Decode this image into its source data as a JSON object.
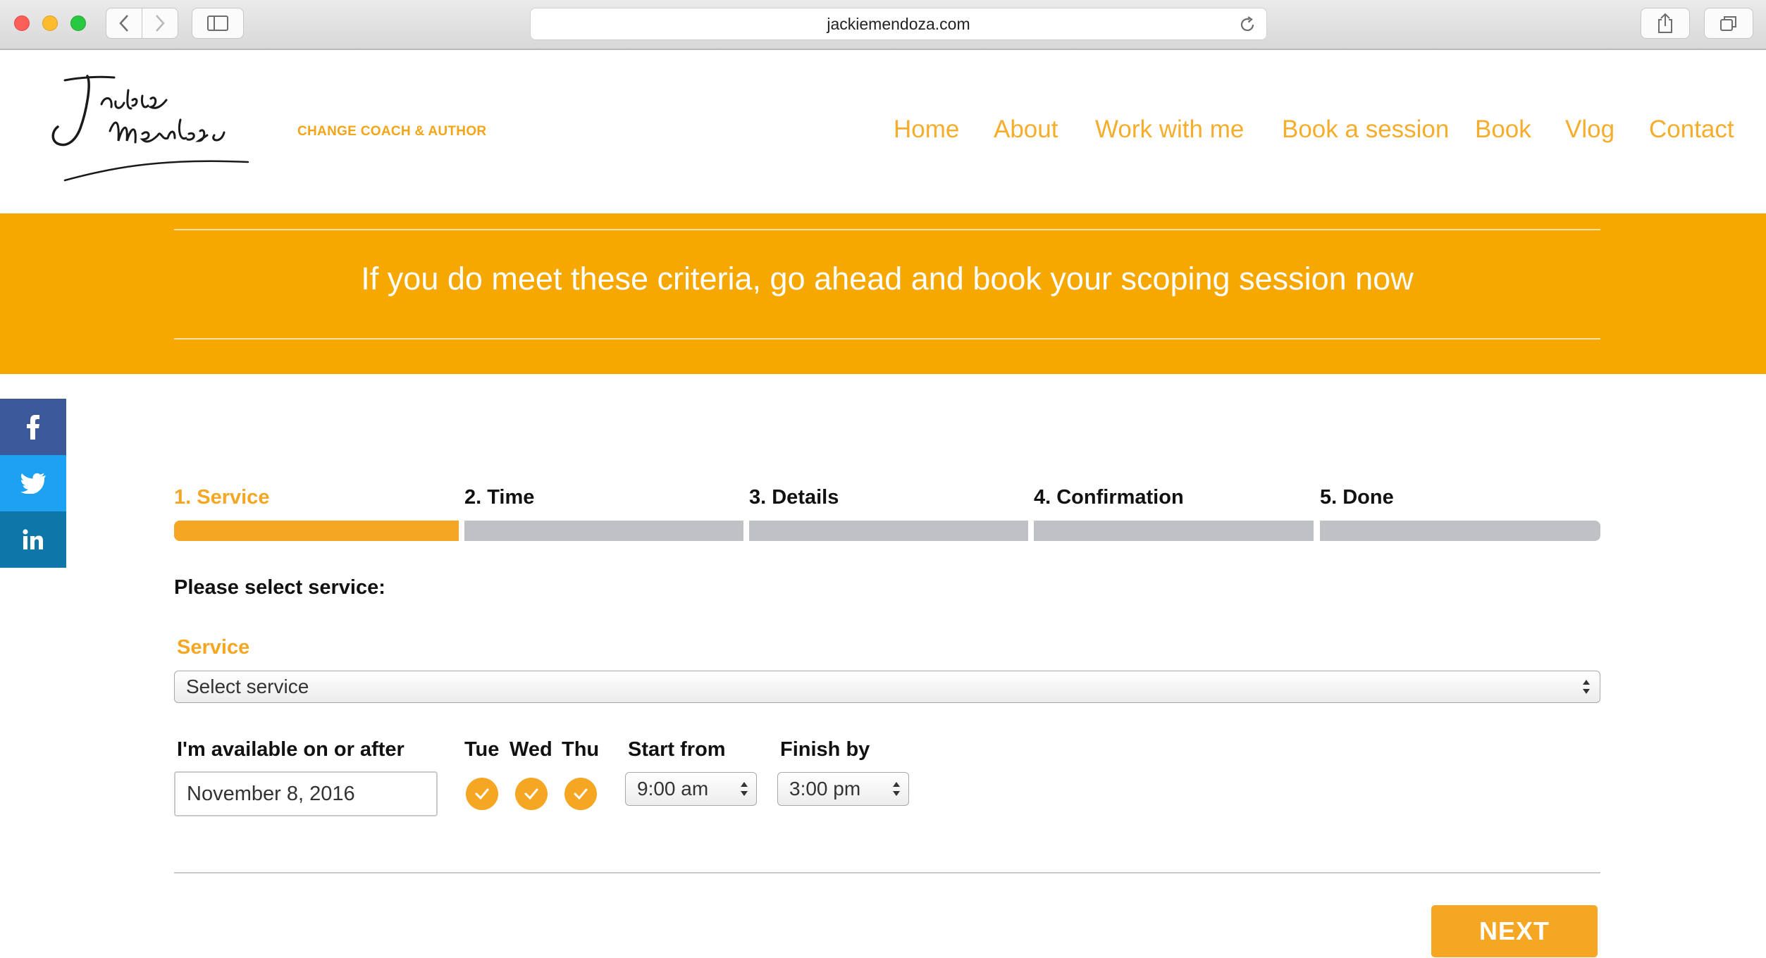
{
  "browser": {
    "url": "jackiemendoza.com"
  },
  "site": {
    "logo_text": "Jackie Mendoza",
    "tagline": "CHANGE COACH & AUTHOR",
    "nav": [
      "Home",
      "About",
      "Work with me",
      "Book a session",
      "Book",
      "Vlog",
      "Contact"
    ],
    "accent_color": "#f6a700"
  },
  "banner": {
    "text": "If you do meet these criteria, go ahead and book your scoping session now"
  },
  "social": [
    "facebook-icon",
    "twitter-icon",
    "linkedin-icon"
  ],
  "booking": {
    "steps": [
      "1. Service",
      "2. Time",
      "3. Details",
      "4. Confirmation",
      "5. Done"
    ],
    "active_step": 1,
    "select_heading": "Please select service:",
    "service_label": "Service",
    "service_select_value": "Select service",
    "available_label": "I'm available on or after",
    "date_value": "November 8, 2016",
    "days": [
      "Tue",
      "Wed",
      "Thu"
    ],
    "start_label": "Start from",
    "start_value": "9:00 am",
    "finish_label": "Finish by",
    "finish_value": "3:00 pm",
    "next_label": "NEXT"
  }
}
